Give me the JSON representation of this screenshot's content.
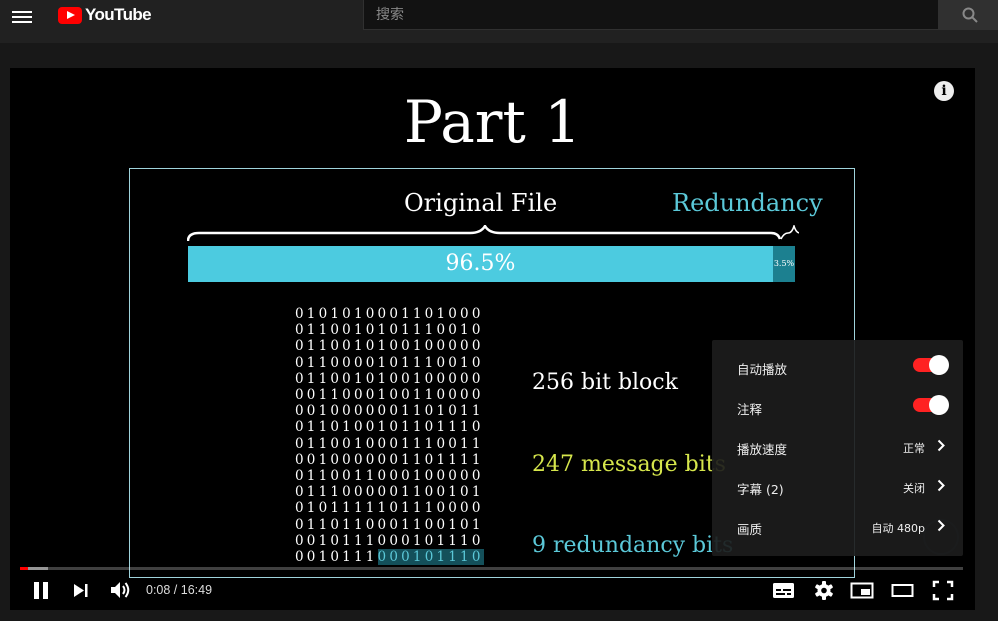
{
  "header": {
    "logo_text": "YouTube",
    "search_placeholder": "搜索"
  },
  "slide": {
    "title": "Part 1",
    "original_file_label": "Original File",
    "redundancy_label": "Redundancy",
    "bar_main_percent": "96.5%",
    "bar_redundancy_percent": "3.5%",
    "bit_rows": [
      "0101010001101000",
      "0110010101110010",
      "0110010100100000",
      "0110000101110010",
      "0110010100100000",
      "0011000100110000",
      "0010000001101011",
      "0110100101101110",
      "0110010001110011",
      "0010000001101111",
      "0110011000100000",
      "0111000001100101",
      "0101111101110000",
      "0110110001100101",
      "0010111000101110"
    ],
    "last_row_plain": "0010111",
    "last_row_highlight": "000101110",
    "block_label": "256 bit block",
    "message_label": "247 message bits",
    "redundancy_bits_label": "9 redundancy bits"
  },
  "settings_menu": {
    "items": [
      {
        "label": "自动播放",
        "toggle_on": true
      },
      {
        "label": "注释",
        "toggle_on": true
      },
      {
        "label": "播放速度",
        "value": "正常"
      },
      {
        "label": "字幕 (2)",
        "value": "关闭"
      },
      {
        "label": "画质",
        "value": "自动 480p"
      }
    ]
  },
  "controls": {
    "time_display": "0:08 / 16:49",
    "played_fraction": 0.008,
    "loaded_fraction": 0.03
  },
  "colors": {
    "accent_red": "#ff0000",
    "slide_cyan": "#4ccbe0",
    "slide_yellow": "#d6e64c"
  }
}
